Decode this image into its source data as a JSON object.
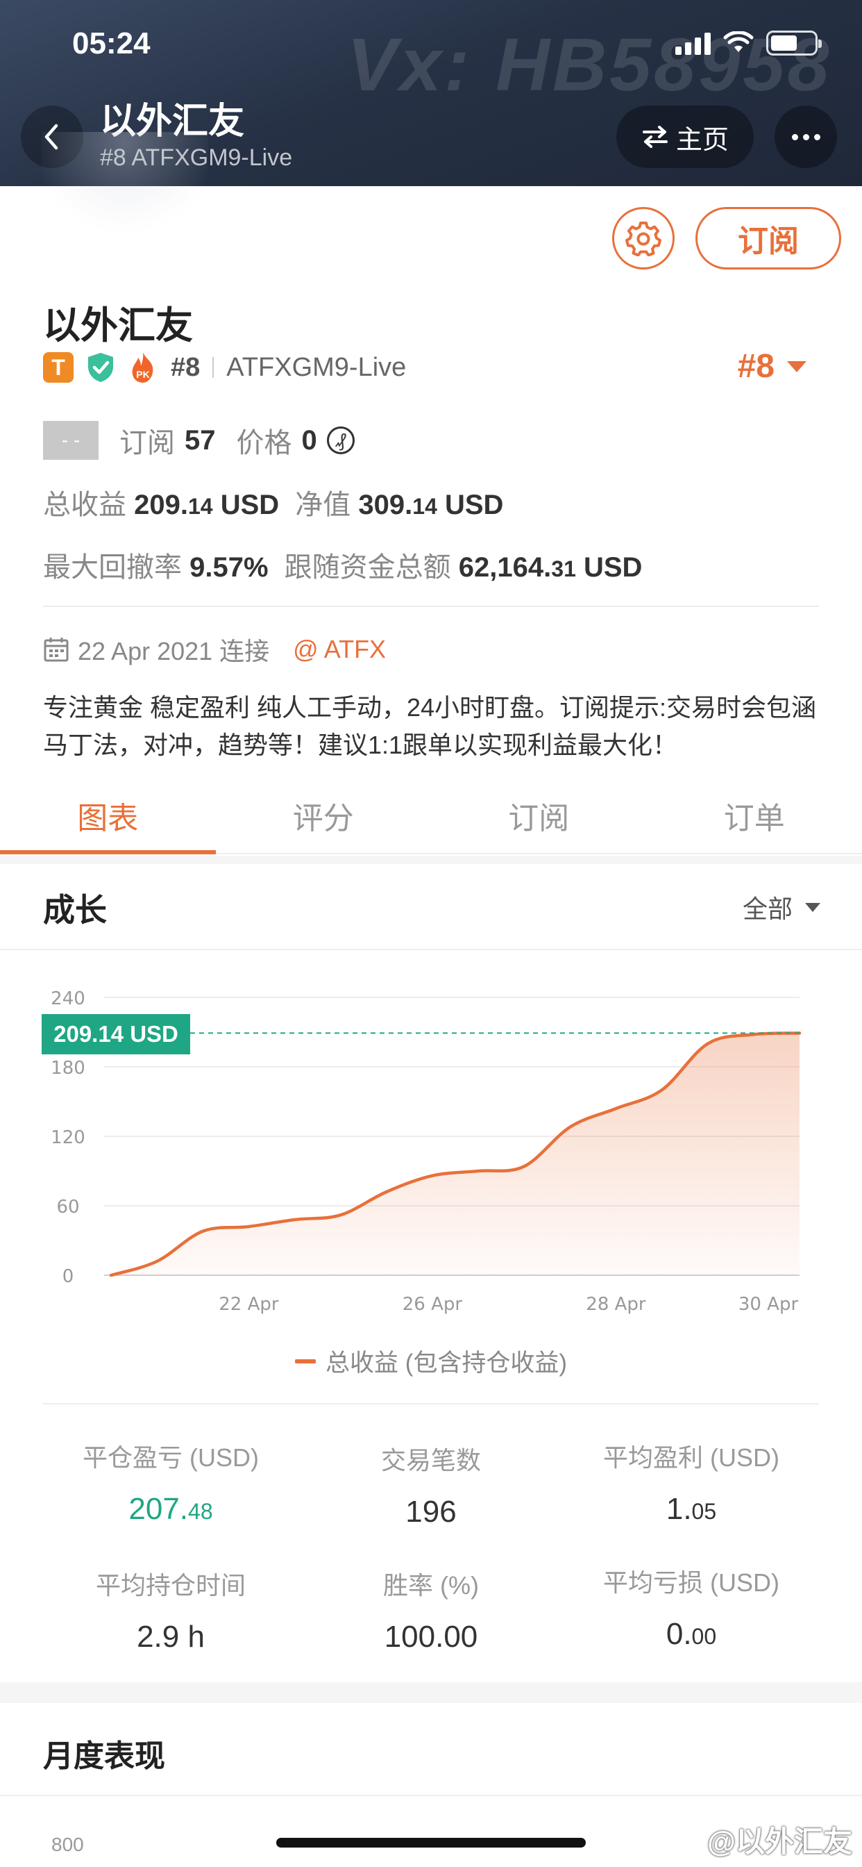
{
  "status_bar": {
    "time": "05:24"
  },
  "header": {
    "title": "以外汇友",
    "subtitle": "#8 ATFXGM9-Live",
    "home_label": "主页",
    "watermark": "Vx: HB58958"
  },
  "profile": {
    "subscribe_label": "订阅",
    "name": "以外汇友",
    "badge_t": "T",
    "badge_pk": "PK",
    "rank_small": "#8",
    "account": "ATFXGM9-Live",
    "rank_big": "#8",
    "placeholder_box": "- -",
    "subscribers_label": "订阅",
    "subscribers_value": "57",
    "price_label": "价格",
    "price_value": "0",
    "coin_symbol": "₰",
    "total_profit_label": "总收益",
    "total_profit_int": "209.",
    "total_profit_dec": "14",
    "total_profit_unit": " USD",
    "equity_label": "净值",
    "equity_int": "309.",
    "equity_dec": "14",
    "equity_unit": " USD",
    "drawdown_label": "最大回撤率",
    "drawdown_value": "9.57%",
    "follow_label": "跟随资金总额",
    "follow_int": "62,164.",
    "follow_dec": "31",
    "follow_unit": " USD",
    "connect_date": "22 Apr 2021 连接",
    "broker": "@ ATFX",
    "description": "专注黄金 稳定盈利 纯人工手动，24小时盯盘。订阅提示:交易时会包涵马丁法，对冲，趋势等！建议1:1跟单以实现利益最大化！"
  },
  "tabs": [
    "图表",
    "评分",
    "订阅",
    "订单"
  ],
  "growth": {
    "title": "成长",
    "range": "全部",
    "current_label": "209.14 USD",
    "legend": "总收益 (包含持仓收益)"
  },
  "chart_data": {
    "type": "area",
    "series": [
      {
        "name": "总收益 (包含持仓收益)",
        "x": [
          "19 Apr",
          "20 Apr",
          "21 Apr",
          "22 Apr",
          "23 Apr",
          "24 Apr",
          "25 Apr",
          "26 Apr",
          "27 Apr",
          "27 Apr",
          "28 Apr",
          "28 Apr",
          "29 Apr",
          "29 Apr",
          "30 Apr",
          "30 Apr"
        ],
        "values": [
          0,
          12,
          38,
          42,
          48,
          52,
          72,
          86,
          90,
          94,
          128,
          144,
          160,
          200,
          208,
          209.14
        ]
      }
    ],
    "xticks": [
      "22 Apr",
      "26 Apr",
      "28 Apr",
      "30 Apr"
    ],
    "yticks": [
      0,
      60,
      120,
      180,
      240
    ],
    "ylim": [
      0,
      240
    ],
    "current_value": 209.14,
    "grid": true,
    "color": "#e8703a"
  },
  "stats": [
    {
      "label": "平仓盈亏 (USD)",
      "int": "207.",
      "dec": "48",
      "highlight": true
    },
    {
      "label": "交易笔数",
      "int": "196",
      "dec": ""
    },
    {
      "label": "平均盈利 (USD)",
      "int": "1.",
      "dec": "05"
    },
    {
      "label": "平均持仓时间",
      "int": "2.9 h",
      "dec": ""
    },
    {
      "label": "胜率 (%)",
      "int": "100.00",
      "dec": ""
    },
    {
      "label": "平均亏损 (USD)",
      "int": "0.",
      "dec": "00"
    }
  ],
  "monthly": {
    "title": "月度表现",
    "y_top": "800"
  },
  "source_mark": "@以外汇友",
  "colors": {
    "accent": "#e8703a",
    "positive": "#1fa684",
    "header_bg": "#263145"
  }
}
